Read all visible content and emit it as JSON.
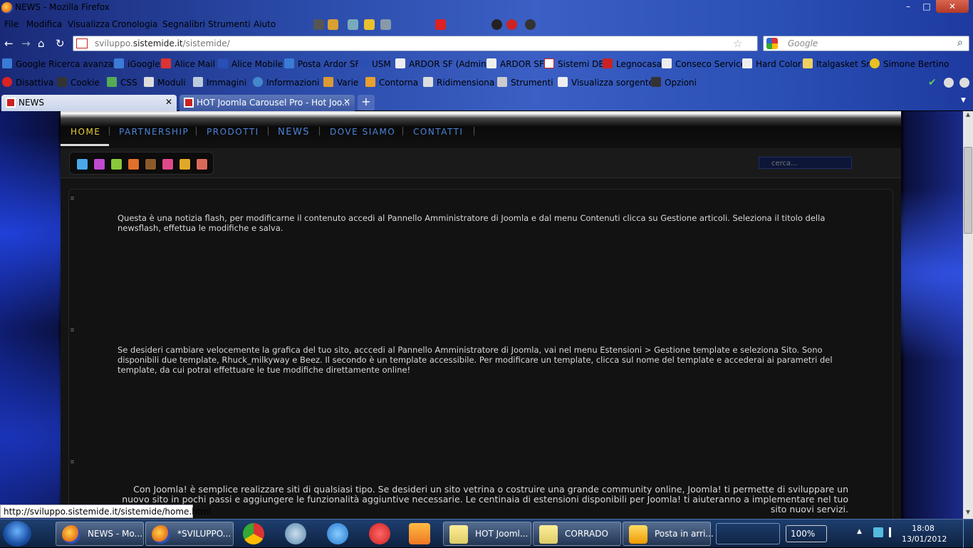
{
  "window": {
    "title": "NEWS - Mozilla Firefox",
    "minimize": "–",
    "maximize": "□",
    "close": "✕"
  },
  "menu": [
    "File",
    "Modifica",
    "Visualizza",
    "Cronologia",
    "Segnalibri",
    "Strumenti",
    "Aiuto"
  ],
  "nav": {
    "back": "←",
    "forward": "→",
    "home": "⌂",
    "reload": "↻",
    "url_domain": "sviluppo.",
    "url_host": "sistemide.it",
    "url_path": "/sistemide/",
    "search_placeholder": "Google"
  },
  "bookmarks": [
    "Google Ricerca avanzata",
    "iGoogle",
    "Alice Mail",
    "Alice Mobile",
    "Posta Ardor SF",
    "USM",
    "ARDOR SF (Admin)",
    "ARDOR SF",
    "Sistemi DE",
    "Legnocasa",
    "Conseco Service",
    "Hard Color",
    "Italgasket Srl",
    "Simone Bertino"
  ],
  "devbar": [
    "Disattiva",
    "Cookie",
    "CSS",
    "Moduli",
    "Immagini",
    "Informazioni",
    "Varie",
    "Contorna",
    "Ridimensiona",
    "Strumenti",
    "Visualizza sorgente",
    "Opzioni"
  ],
  "tabs": [
    {
      "label": "NEWS",
      "close": "✕"
    },
    {
      "label": "HOT Joomla Carousel Pro - Hot Joo...",
      "close": "✕"
    }
  ],
  "newtab": "+",
  "site": {
    "nav": [
      "HOME",
      "PARTNERSHIP",
      "PRODOTTI",
      "NEWS",
      "DOVE SIAMO",
      "CONTATTI"
    ],
    "swatch_colors": [
      "#4aa8e8",
      "#c04ad0",
      "#88c83a",
      "#e0702a",
      "#8a5a2a",
      "#e04a8a",
      "#e0a82a",
      "#d86a5a"
    ],
    "search_placeholder": "cerca...",
    "paragraphs": [
      "Questa è una notizia flash, per modificarne il contenuto accedi al Pannello Amministratore di Joomla e dal menu Contenuti clicca su Gestione articoli. Seleziona il titolo della newsflash, effettua le modifiche e salva.",
      "Se desideri cambiare velocemente la grafica del tuo sito, acccedi al Pannello Amministratore di Joomla, vai nel menu Estensioni > Gestione template e seleziona Sito. Sono disponibili due template, Rhuck_milkyway e Beez. Il secondo è un template accessibile. Per modificare un template, clicca sul nome del template e accederai ai parametri del template, da cui potrai effettuare le tue modifiche direttamente online!",
      "Con Joomla! è semplice realizzare siti di qualsiasi tipo. Se desideri un sito vetrina o costruire una grande community online, Joomla! ti permette di sviluppare un nuovo sito in pochi passi e aggiungere le funzionalità aggiuntive necessarie. Le centinaia di estensioni disponibili per Joomla! ti aiuteranno a implementare nel tuo sito nuovi servizi."
    ]
  },
  "status_url": "http://sviluppo.sistemide.it/sistemide/home.html",
  "taskbar": {
    "items": [
      "NEWS - Mo...",
      "*SVILUPPO...",
      "HOT Jooml...",
      "CORRADO",
      "Posta in arri..."
    ],
    "battery": "100%",
    "time": "18:08",
    "date": "13/01/2012"
  }
}
